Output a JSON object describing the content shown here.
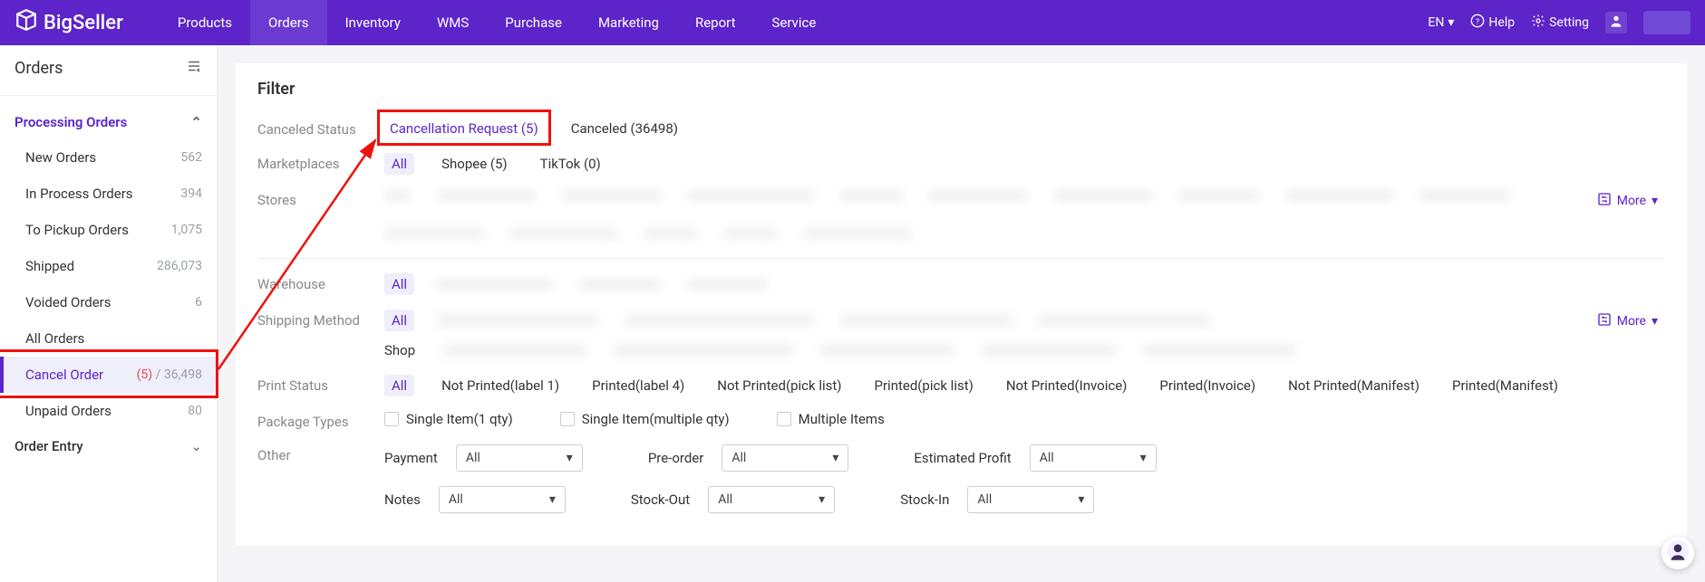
{
  "brand": "BigSeller",
  "topnav": {
    "products": "Products",
    "orders": "Orders",
    "inventory": "Inventory",
    "wms": "WMS",
    "purchase": "Purchase",
    "marketing": "Marketing",
    "report": "Report",
    "service": "Service"
  },
  "topright": {
    "lang": "EN",
    "help": "Help",
    "setting": "Setting"
  },
  "sidebar": {
    "title": "Orders",
    "group1": "Processing Orders",
    "items": [
      {
        "label": "New Orders",
        "count": "562"
      },
      {
        "label": "In Process Orders",
        "count": "394"
      },
      {
        "label": "To Pickup Orders",
        "count": "1,075"
      },
      {
        "label": "Shipped",
        "count": "286,073"
      },
      {
        "label": "Voided Orders",
        "count": "6"
      },
      {
        "label": "All Orders",
        "count": ""
      },
      {
        "label": "Cancel Order",
        "count_hi": "(5)",
        "count_sep": " / ",
        "count_post": "36,498"
      },
      {
        "label": "Unpaid Orders",
        "count": "80"
      }
    ],
    "group2": "Order Entry"
  },
  "filter": {
    "heading": "Filter",
    "labels": {
      "canceled_status": "Canceled Status",
      "marketplaces": "Marketplaces",
      "stores": "Stores",
      "warehouse": "Warehouse",
      "shipping_method": "Shipping Method",
      "print_status": "Print Status",
      "package_types": "Package Types",
      "other": "Other"
    },
    "canceled_status": {
      "req": "Cancellation Request (5)",
      "canceled": "Canceled (36498)"
    },
    "marketplaces": {
      "all": "All",
      "shopee": "Shopee (5)",
      "tiktok": "TikTok (0)"
    },
    "more": "More",
    "warehouse_all": "All",
    "shipping_all": "All",
    "shipping_shop": "Shop",
    "print_status_values": {
      "all": "All",
      "np_label": "Not Printed(label 1)",
      "p_label": "Printed(label 4)",
      "np_pick": "Not Printed(pick list)",
      "p_pick": "Printed(pick list)",
      "np_inv": "Not Printed(Invoice)",
      "p_inv": "Printed(Invoice)",
      "np_man": "Not Printed(Manifest)",
      "p_man": "Printed(Manifest)"
    },
    "package_types": {
      "single1": "Single Item(1 qty)",
      "singlem": "Single Item(multiple qty)",
      "multi": "Multiple Items"
    },
    "other": {
      "payment": "Payment",
      "preorder": "Pre-order",
      "est_profit": "Estimated Profit",
      "notes": "Notes",
      "stockout": "Stock-Out",
      "stockin": "Stock-In",
      "all": "All"
    }
  }
}
